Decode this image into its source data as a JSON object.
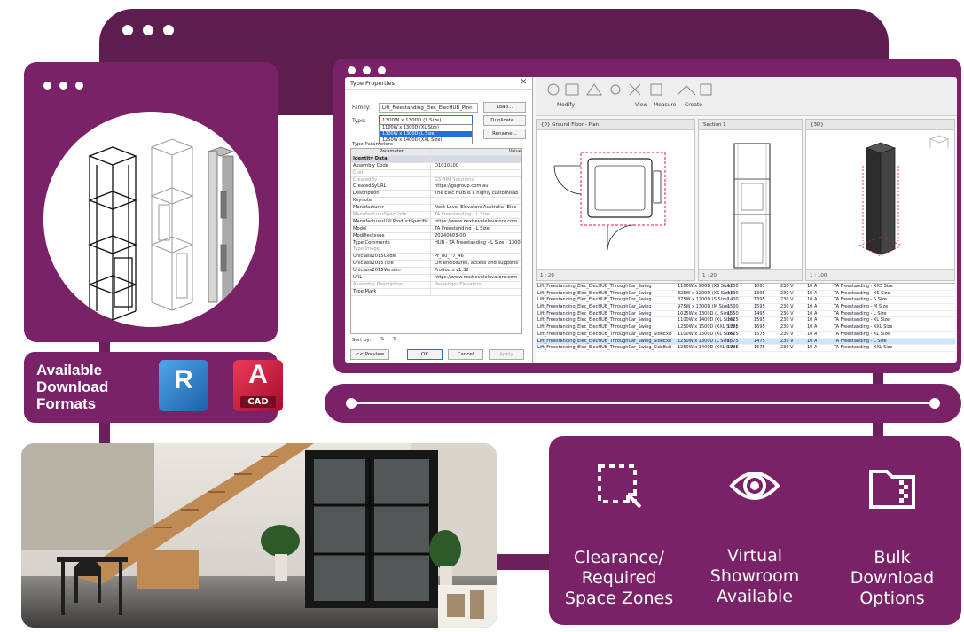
{
  "formats": {
    "heading": "Available\nDownload\nFormats",
    "revit_letter": "R",
    "autocad_letter": "A",
    "autocad_sub": "CAD"
  },
  "dialog": {
    "title": "Type Properties",
    "family_label": "Family:",
    "family_value": "Lift_Freestanding_Elec_ElecHUB_Pinn",
    "type_label": "Type:",
    "type_value": "1300W x 1300D (L Size)",
    "load_button": "Load...",
    "duplicate_button": "Duplicate...",
    "rename_button": "Rename...",
    "type_options": [
      {
        "label": "1100W x 1300D (XL Size)",
        "selected": false
      },
      {
        "label": "1300W x 1300D (L Size)",
        "selected": true
      },
      {
        "label": "1250W x 1400D (XXL Size)",
        "selected": false
      }
    ],
    "type_params_label": "Type Parameters",
    "col_parameter": "Parameter",
    "col_value": "Value",
    "rows": [
      {
        "p": "Identity Data",
        "v": "",
        "kind": "group"
      },
      {
        "p": "Assembly Code",
        "v": "D1010100",
        "kind": "normal"
      },
      {
        "p": "Cost",
        "v": "",
        "kind": "dim"
      },
      {
        "p": "CreatedBy",
        "v": "GS-BIM Solutions",
        "kind": "dim"
      },
      {
        "p": "CreatedByURL",
        "v": "https://gsgroup.com.au",
        "kind": "normal"
      },
      {
        "p": "Description",
        "v": "The Elec HUB is a highly customisab",
        "kind": "normal"
      },
      {
        "p": "Keynote",
        "v": "",
        "kind": "normal"
      },
      {
        "p": "Manufacturer",
        "v": "Next Level Elevators Australia (Elec",
        "kind": "normal"
      },
      {
        "p": "ManufacturerSpecCode",
        "v": "TA Freestanding - L Size",
        "kind": "dim"
      },
      {
        "p": "ManufacturerURLProductSpecific",
        "v": "https://www.nextlevelelevators.com",
        "kind": "normal"
      },
      {
        "p": "Model",
        "v": "TA Freestanding - L Size",
        "kind": "normal"
      },
      {
        "p": "ModifiedIssue",
        "v": "20240603-00",
        "kind": "normal"
      },
      {
        "p": "Type Comments",
        "v": "HUB - TA Freestanding - L Size - 1300",
        "kind": "normal"
      },
      {
        "p": "Type Image",
        "v": "",
        "kind": "dim"
      },
      {
        "p": "Uniclass2015Code",
        "v": "Pr_80_77_46",
        "kind": "normal"
      },
      {
        "p": "Uniclass2015Title",
        "v": "Lift enclosures, access and supports",
        "kind": "normal"
      },
      {
        "p": "Uniclass2015Version",
        "v": "Products v1.32",
        "kind": "normal"
      },
      {
        "p": "URL",
        "v": "https://www.nextlevelelevators.com",
        "kind": "normal"
      },
      {
        "p": "Assembly Description",
        "v": "Passenger Elevators",
        "kind": "dim"
      },
      {
        "p": "Type Mark",
        "v": "",
        "kind": "normal"
      }
    ],
    "sort_by_label": "Sort by:",
    "preview_button": "<< Preview",
    "ok_button": "OK",
    "cancel_button": "Cancel",
    "apply_button": "Apply"
  },
  "ribbon": {
    "modify_label": "Modify",
    "view_label": "View",
    "measure_label": "Measure",
    "create_label": "Create"
  },
  "views": {
    "floor_plan_tab": "{0} Ground Floor - Plan",
    "section_tab": "Section 1",
    "threed_tab": "{3D}",
    "floor_plan_scale": "1 : 20",
    "section_scale": "1 : 20",
    "threed_scale": "1 : 100"
  },
  "schedule": {
    "rows": [
      {
        "name": "Lift_Freestanding_Elec_ElecHUB_ThroughCar_Swing",
        "size": "1100W x 900D (XS Size)",
        "a": "1250",
        "b": "1081",
        "v": "230 V",
        "amp": "10 A",
        "desc": "TA Freestanding - XXS Size",
        "sel": false
      },
      {
        "name": "Lift_Freestanding_Elec_ElecHUB_ThroughCar_Swing",
        "size": "825W x 1200D (XS Size)",
        "a": "1330",
        "b": "1395",
        "v": "230 V",
        "amp": "10 A",
        "desc": "TA Freestanding - XS Size",
        "sel": false
      },
      {
        "name": "Lift_Freestanding_Elec_ElecHUB_ThroughCar_Swing",
        "size": "875W x 1200D (S Size)",
        "a": "1400",
        "b": "1395",
        "v": "230 V",
        "amp": "10 A",
        "desc": "TA Freestanding - S Size",
        "sel": false
      },
      {
        "name": "Lift_Freestanding_Elec_ElecHUB_ThroughCar_Swing",
        "size": "975W x 1300D (M Size)",
        "a": "1500",
        "b": "1595",
        "v": "230 V",
        "amp": "10 A",
        "desc": "TA Freestanding - M Size",
        "sel": false
      },
      {
        "name": "Lift_Freestanding_Elec_ElecHUB_ThroughCar_Swing",
        "size": "1025W x 1300D (L Size)",
        "a": "1550",
        "b": "1495",
        "v": "230 V",
        "amp": "10 A",
        "desc": "TA Freestanding - L Size",
        "sel": false
      },
      {
        "name": "Lift_Freestanding_Elec_ElecHUB_ThroughCar_Swing",
        "size": "1100W x 1400D (XL Size)",
        "a": "1625",
        "b": "1595",
        "v": "230 V",
        "amp": "10 A",
        "desc": "TA Freestanding - XL Size",
        "sel": false
      },
      {
        "name": "Lift_Freestanding_Elec_ElecHUB_ThroughCar_Swing",
        "size": "1250W x 1500D (XXL Size)",
        "a": "1775",
        "b": "1695",
        "v": "230 V",
        "amp": "10 A",
        "desc": "TA Freestanding - XXL Size",
        "sel": false
      },
      {
        "name": "Lift_Freestanding_Elec_ElecHUB_ThroughCar_Swing_SideExit",
        "size": "1100W x 1300D (XL Size)",
        "a": "1625",
        "b": "1575",
        "v": "230 V",
        "amp": "10 A",
        "desc": "TA Freestanding - XL Size",
        "sel": false
      },
      {
        "name": "Lift_Freestanding_Elec_ElecHUB_ThroughCar_Swing_SideExit",
        "size": "1250W x 1300D (L Size)",
        "a": "1675",
        "b": "1475",
        "v": "230 V",
        "amp": "10 A",
        "desc": "TA Freestanding - L Size",
        "sel": true
      },
      {
        "name": "Lift_Freestanding_Elec_ElecHUB_ThroughCar_Swing_SideExit",
        "size": "1250W x 1400D (XXL Size)",
        "a": "1725",
        "b": "1675",
        "v": "230 V",
        "amp": "10 A",
        "desc": "TA Freestanding - XXL Size",
        "sel": false
      }
    ]
  },
  "slider": {
    "position": 0.0
  },
  "features": [
    {
      "icon": "clearance-zone-icon",
      "label": "Clearance/\nRequired\nSpace Zones"
    },
    {
      "icon": "eye-icon",
      "label": "Virtual\nShowroom\nAvailable"
    },
    {
      "icon": "folder-zip-icon",
      "label": "Bulk\nDownload\nOptions"
    }
  ],
  "colors": {
    "purple": "#7a2268",
    "dark_purple": "#5e1d4f",
    "revit_blue": "#1d5fa8",
    "autocad_red": "#a10e2c"
  }
}
